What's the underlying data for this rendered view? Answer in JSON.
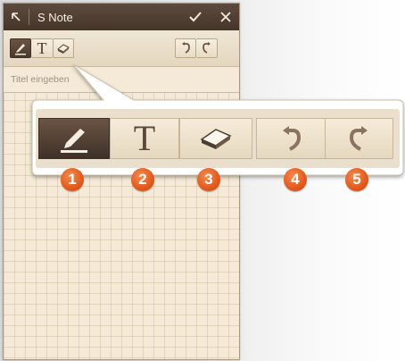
{
  "app": {
    "title": "S Note",
    "title_placeholder": "Titel eingeben"
  },
  "toolbar": {
    "tools": [
      {
        "name": "pen",
        "icon": "pen-icon",
        "active": true
      },
      {
        "name": "text",
        "icon": "text-icon",
        "label": "T"
      },
      {
        "name": "eraser",
        "icon": "eraser-icon"
      }
    ],
    "history": [
      {
        "name": "undo",
        "icon": "undo-icon"
      },
      {
        "name": "redo",
        "icon": "redo-icon"
      }
    ]
  },
  "callout": {
    "markers": [
      "1",
      "2",
      "3",
      "4",
      "5"
    ]
  },
  "colors": {
    "titlebar": "#4e3d31",
    "paper": "#f4ead7",
    "marker": "#e25a1c"
  }
}
